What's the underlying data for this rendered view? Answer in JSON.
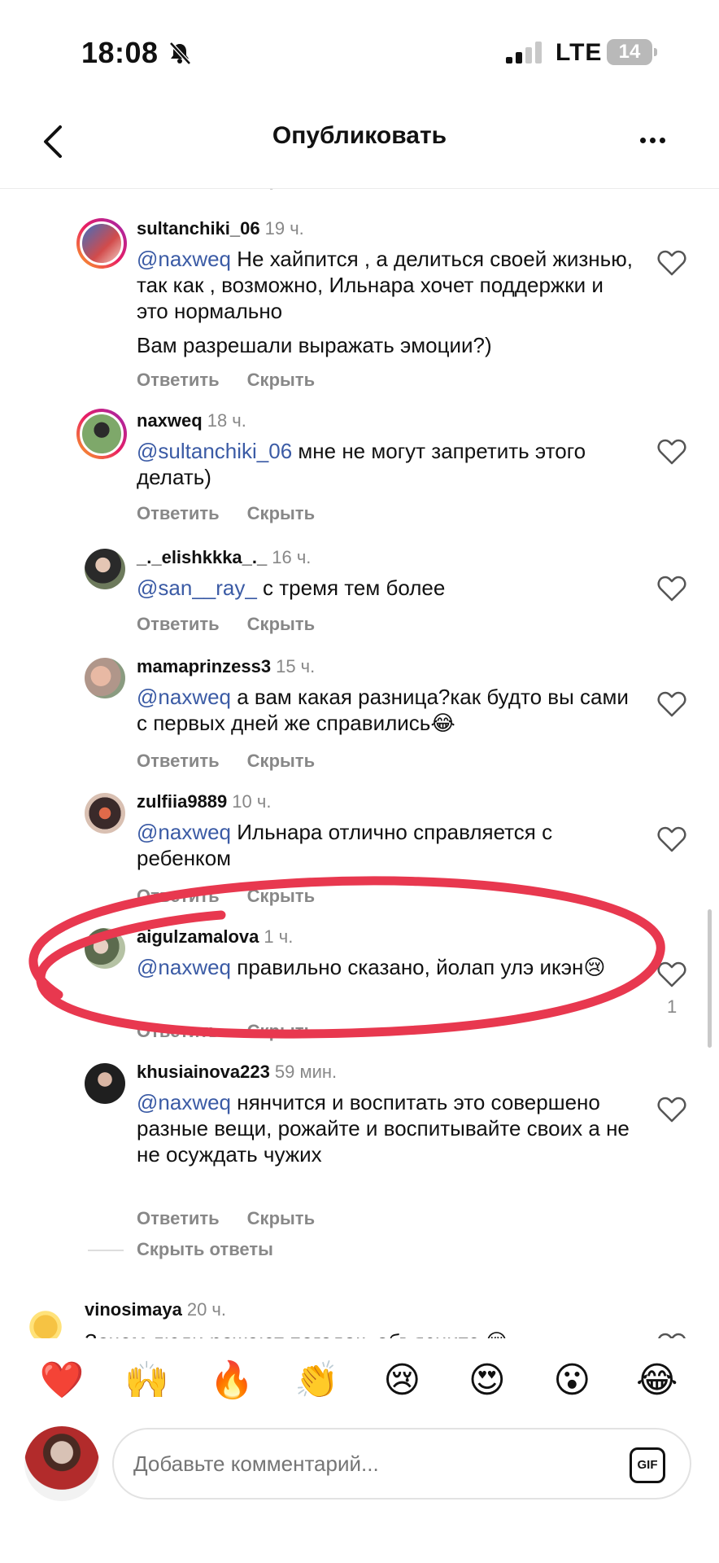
{
  "status_bar": {
    "time": "18:08",
    "network": "LTE",
    "battery": "14"
  },
  "header": {
    "title": "Опубликовать"
  },
  "actions": {
    "reply": "Ответить",
    "hide": "Скрыть"
  },
  "comments": [
    {
      "user": "sultanchiki_06",
      "time": "19 ч.",
      "mention": "@naxweq",
      "text": " Не хайпится , а делиться своей жизнью, так как , возможно, Ильнара хочет поддержки и это нормально",
      "text2": "Вам разрешали выражать эмоции?)",
      "avatar_color": "#d24b4b"
    },
    {
      "user": "naxweq",
      "time": "18 ч.",
      "mention": "@sultanchiki_06",
      "text": " мне не могут запретить этого делать)",
      "avatar_color": "#5c8a4c"
    },
    {
      "user": "_._elishkkka_._",
      "time": "16 ч.",
      "mention": "@san__ray_",
      "text": " с тремя тем более",
      "avatar_color": "#3a3a3a"
    },
    {
      "user": "mamaprinzess3",
      "time": "15 ч.",
      "mention": "@naxweq",
      "text": " а вам какая разница?как будто вы сами с первых дней же справились😂",
      "avatar_color": "#b89a86"
    },
    {
      "user": "zulfiia9889",
      "time": "10 ч.",
      "mention": "@naxweq",
      "text": " Ильнара отлично справляется с ребенком",
      "avatar_color": "#7a4a4a"
    },
    {
      "user": "aigulzamalova",
      "time": "1 ч.",
      "mention": "@naxweq",
      "text": " правильно сказано, йолап улэ икэн😢",
      "likes": "1",
      "avatar_color": "#6b7f5e"
    },
    {
      "user": "khusiainova223",
      "time": "59 мин.",
      "mention": "@naxweq",
      "text": "  нянчится и воспитать это совершено разные вещи, рожайте и воспитывайте своих а не не осуждать чужих",
      "avatar_color": "#2b2b2b"
    },
    {
      "user": "vinosimaya",
      "time": "20 ч.",
      "mention": "",
      "text": "Зачем люди рожают погодок, объясните 😢",
      "avatar_color": "#f6c343"
    }
  ],
  "hide_replies": "Скрыть ответы",
  "emoji_bar": [
    "❤️",
    "🙌",
    "🔥",
    "👏",
    "😢",
    "😍",
    "😮",
    "😂"
  ],
  "composer": {
    "placeholder": "Добавьте комментарий...",
    "gif_label": "GIF"
  },
  "colors": {
    "mention": "#3b5ba5",
    "muted": "#888888",
    "annotation": "#e8384f"
  }
}
